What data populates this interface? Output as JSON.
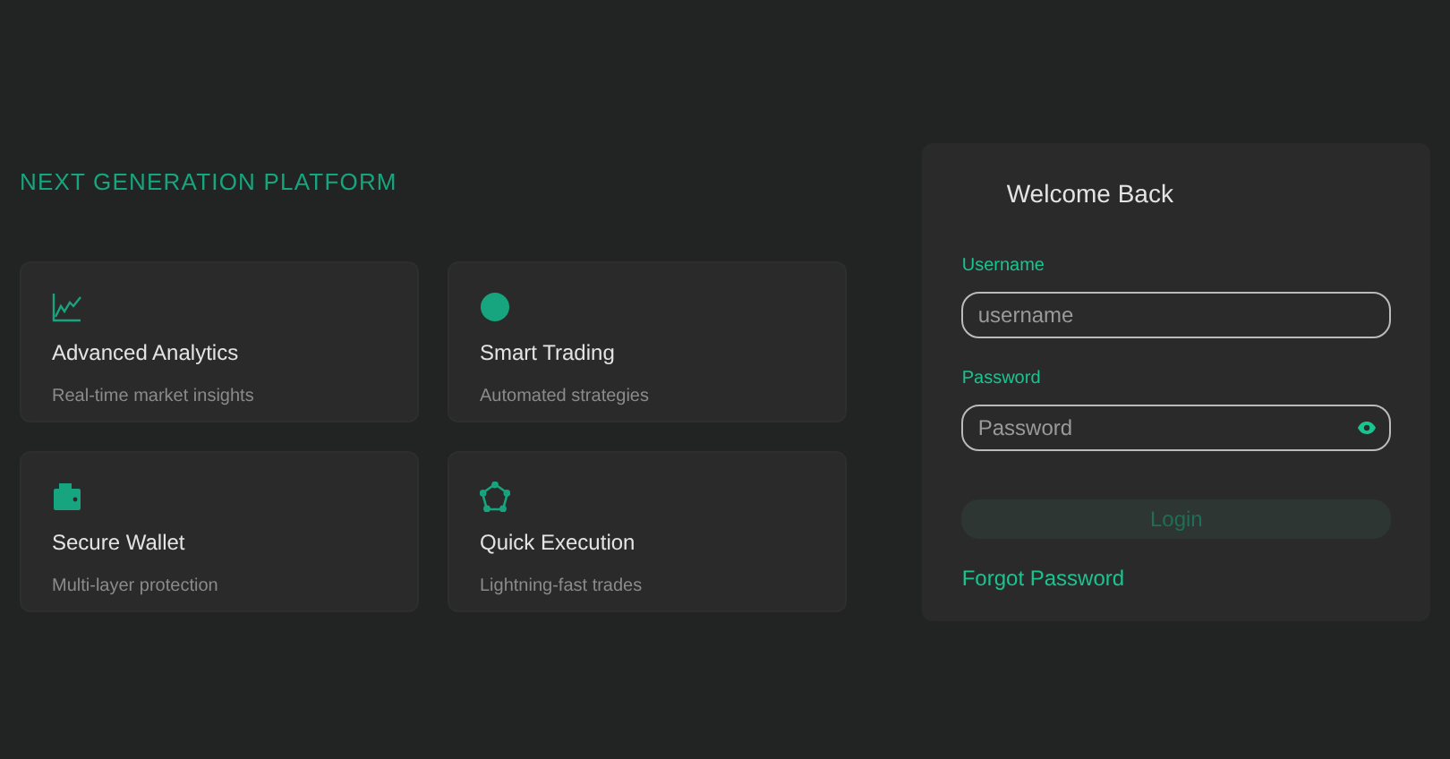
{
  "hero": {
    "tagline": "NEXT GENERATION PLATFORM"
  },
  "features": [
    {
      "kind": "chart",
      "title": "Advanced Analytics",
      "subtitle": "Real-time market insights"
    },
    {
      "kind": "dot",
      "title": "Smart Trading",
      "subtitle": "Automated strategies"
    },
    {
      "kind": "wallet",
      "title": "Secure Wallet",
      "subtitle": "Multi-layer protection"
    },
    {
      "kind": "network",
      "title": "Quick Execution",
      "subtitle": "Lightning-fast trades"
    }
  ],
  "login": {
    "title": "Welcome Back",
    "fields": [
      {
        "label": "Username",
        "placeholder": "username",
        "kind": "text"
      },
      {
        "label": "Password",
        "placeholder": "Password",
        "kind": "password"
      }
    ],
    "button": {
      "label": "Login",
      "disabled": true
    },
    "forgot_link": "Forgot Password"
  }
}
